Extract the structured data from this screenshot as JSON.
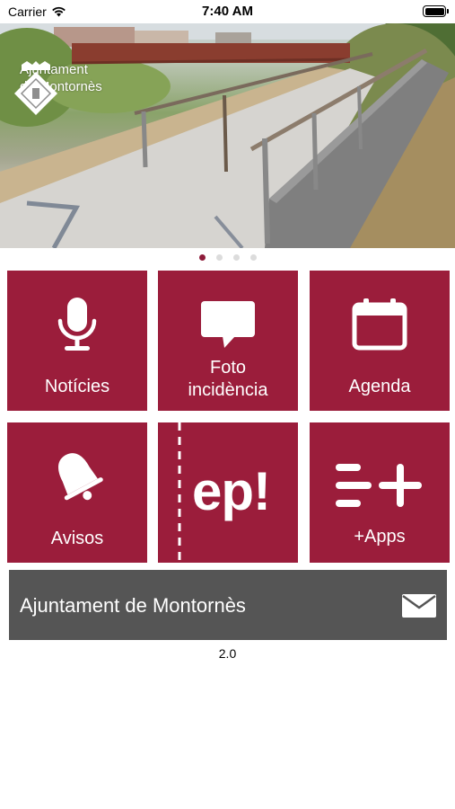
{
  "status_bar": {
    "carrier": "Carrier",
    "time": "7:40 AM",
    "battery_level": 1.0
  },
  "header": {
    "logo_line1": "Ajuntament",
    "logo_line2": "de Montornès"
  },
  "pager": {
    "count": 4,
    "active_index": 0
  },
  "tiles": [
    {
      "label": "Notícies",
      "icon": "microphone-icon"
    },
    {
      "label_line1": "Foto",
      "label_line2": "incidència",
      "icon": "speech-bubble-icon"
    },
    {
      "label": "Agenda",
      "icon": "calendar-icon"
    },
    {
      "label": "Avisos",
      "icon": "bell-icon"
    },
    {
      "label": "ep!",
      "icon": "ep-logo"
    },
    {
      "label": "+Apps",
      "icon": "menu-plus-icon"
    }
  ],
  "contact": {
    "label": "Ajuntament de Montornès",
    "icon": "mail-icon"
  },
  "version": "2.0",
  "colors": {
    "tile": "#9b1d3b",
    "contact_bar": "#555555",
    "dot_active": "#8e1c3a",
    "dot_inactive": "#dcdcdc"
  }
}
